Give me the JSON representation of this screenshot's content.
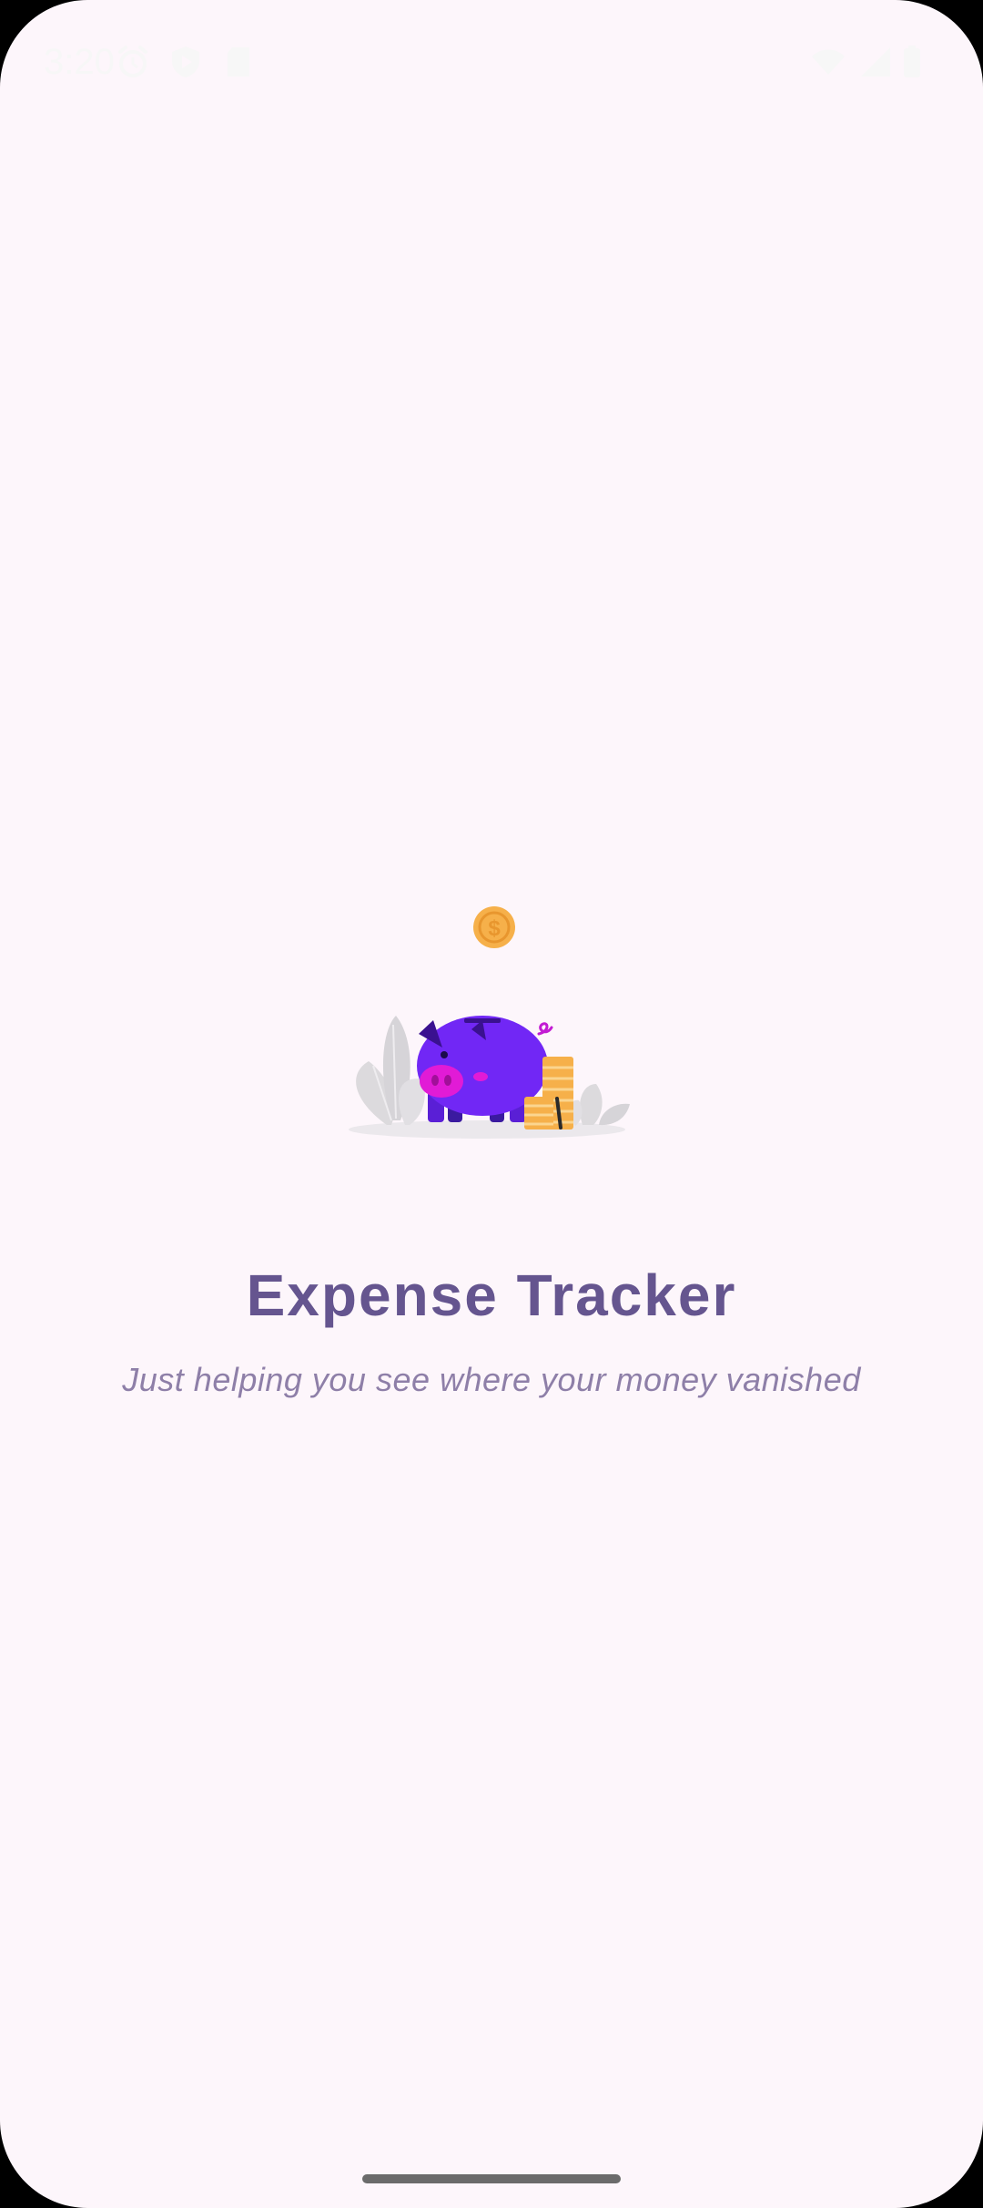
{
  "status_bar": {
    "time": "3:20",
    "icons_left": [
      "alarm-icon",
      "shield-play-icon",
      "sd-card-icon"
    ],
    "icons_right": [
      "wifi-icon",
      "cellular-signal-icon",
      "battery-icon"
    ]
  },
  "splash": {
    "illustration": "piggy-bank-with-coins",
    "title": "Expense Tracker",
    "tagline": "Just helping you see where your money vanished"
  },
  "colors": {
    "background": "#fdf6fb",
    "title": "#65558f",
    "tagline": "#8e7fa8",
    "pig": "#7127f5",
    "pig_snout": "#e11bd6",
    "coin": "#f6b04a"
  }
}
